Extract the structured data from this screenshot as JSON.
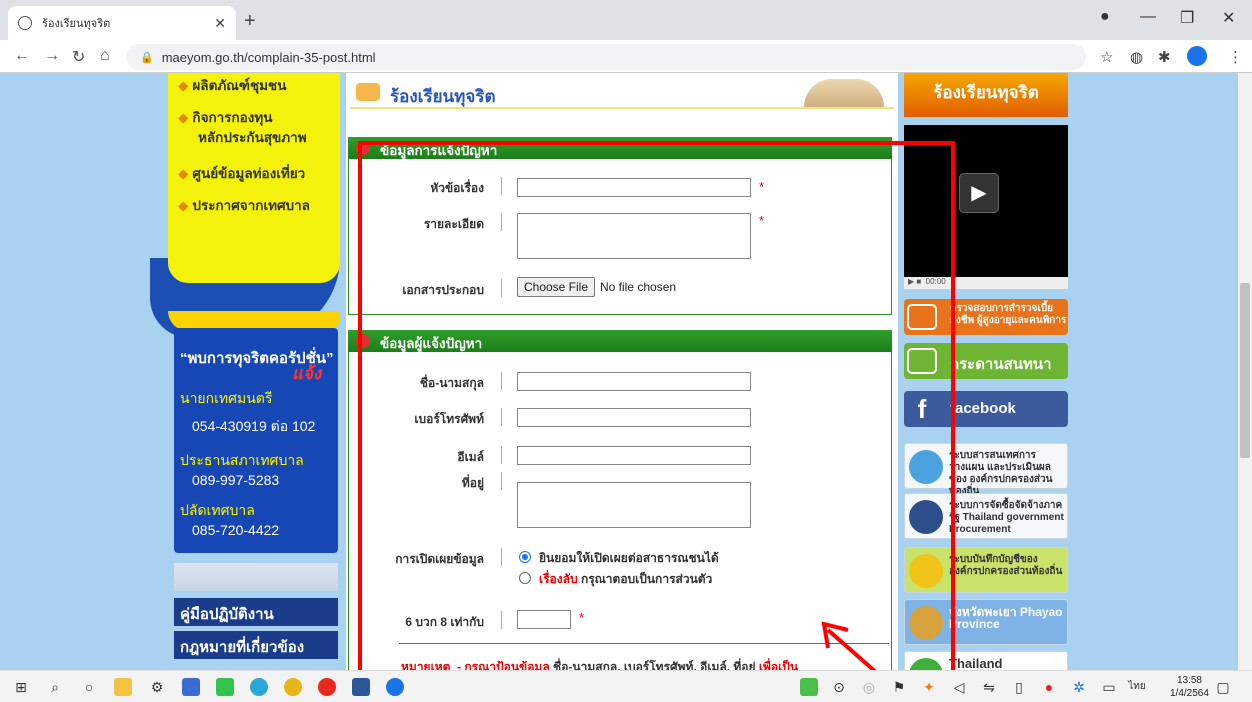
{
  "browser": {
    "tab_title": "ร้องเรียนทุจริต",
    "url": "maeyom.go.th/complain-35-post.html"
  },
  "left_menu": {
    "items": [
      "ผลิตภัณฑ์ชุมชน",
      "กิจการกองทุน",
      "หลักประกันสุขภาพ",
      "ศูนย์ข้อมูลท่องเที่ยว",
      "ประกาศจากเทศบาล"
    ]
  },
  "corruption_box": {
    "title": "“พบการทุจริตคอรัปชั่น”",
    "sub": "แจ้ง",
    "mayor_label": "นายกเทศมนตรี",
    "mayor_phone": "054-430919 ต่อ 102",
    "council_label": "ประธานสภาเทศบาล",
    "council_phone": "089-997-5283",
    "clerk_label": "ปลัดเทศบาล",
    "clerk_phone": "085-720-4422"
  },
  "left_buttons": {
    "manual": "คู่มือปฏิบัติงาน",
    "law": "กฎหมายที่เกี่ยวข้อง"
  },
  "content": {
    "page_title": "ร้องเรียนทุจริต",
    "section1_title": "ข้อมูลการแจ้งปัญหา",
    "subject_label": "หัวข้อเรื่อง",
    "detail_label": "รายละเอียด",
    "attachment_label": "เอกสารประกอบ",
    "choose_file": "Choose File",
    "no_file": "No file chosen",
    "section2_title": "ข้อมูลผู้แจ้งปัญหา",
    "name_label": "ชื่อ-นามสกุล",
    "phone_label": "เบอร์โทรศัพท์",
    "email_label": "อีเมล์",
    "address_label": "ที่อยู่",
    "disclose_label": "การเปิดเผยข้อมูล",
    "disclose_opt1": "ยินยอมให้เปิดเผยต่อสาธารณชนได้",
    "disclose_opt2_red": "เรื่องลับ",
    "disclose_opt2": "กรุณาตอบเป็นการส่วนตัว",
    "captcha_label": "6 บวก 8 เท่ากับ",
    "required_mark": "*",
    "note_head": "หมายเหตุ",
    "note_text": "- กรุณาป้อนข้อมูล",
    "note_fields": "ชื่อ-นามสกุล, เบอร์โทรศัพท์, อีเมล์, ที่อยู่",
    "note_tail": "เพื่อเป็น"
  },
  "right_column": {
    "header": "ร้องเรียนทุจริต",
    "video_time": "00:00",
    "btn_welfare": "ตรวจสอบการสำรวจเบี้ยยังชีพ ผู้สูงอายุและคนพิการ",
    "btn_webboard": "กระดานสนทนา",
    "btn_facebook": "facebook",
    "banner1": "ระบบสารสนเทศการวางแผน และประเมินผลของ องค์กรปกครองส่วนท้องถิ่น",
    "banner2": "ระบบการจัดซื้อจัดจ้างภาครัฐ Thailand government Procurement",
    "banner3": "ระบบบันทึกบัญชีของ องค์กรปกครองส่วนท้องถิ่น",
    "banner4": "จังหวัดพะเยา Phayao Province",
    "banner5": "Thailand"
  },
  "taskbar": {
    "lang": "ไทย",
    "time": "13:58",
    "date": "1/4/2564"
  }
}
